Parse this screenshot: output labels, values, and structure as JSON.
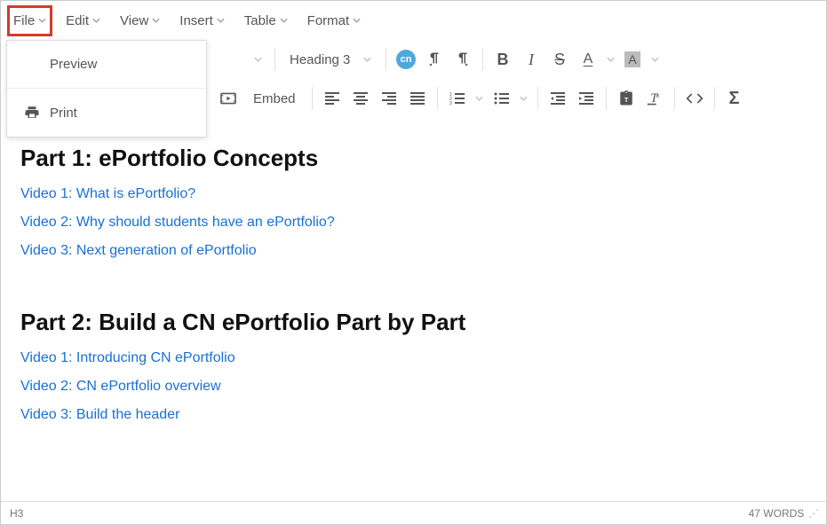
{
  "menubar": {
    "file": "File",
    "edit": "Edit",
    "view": "View",
    "insert": "Insert",
    "table": "Table",
    "format": "Format"
  },
  "file_dropdown": {
    "preview": "Preview",
    "print": "Print"
  },
  "toolbar": {
    "format_select": "Heading 3",
    "embed_label": "Embed"
  },
  "content": {
    "part1_heading": "Part 1: ePortfolio Concepts",
    "part1_links": [
      "Video 1: What is ePortfolio?",
      "Video 2: Why should students have an ePortfolio?",
      "Video 3: Next generation of ePortfolio"
    ],
    "part2_heading": "Part 2: Build a CN ePortfolio Part by Part",
    "part2_links": [
      "Video 1: Introducing CN ePortfolio",
      "Video 2: CN ePortfolio overview",
      "Video 3: Build the header"
    ]
  },
  "statusbar": {
    "path": "H3",
    "wordcount": "47 WORDS"
  }
}
